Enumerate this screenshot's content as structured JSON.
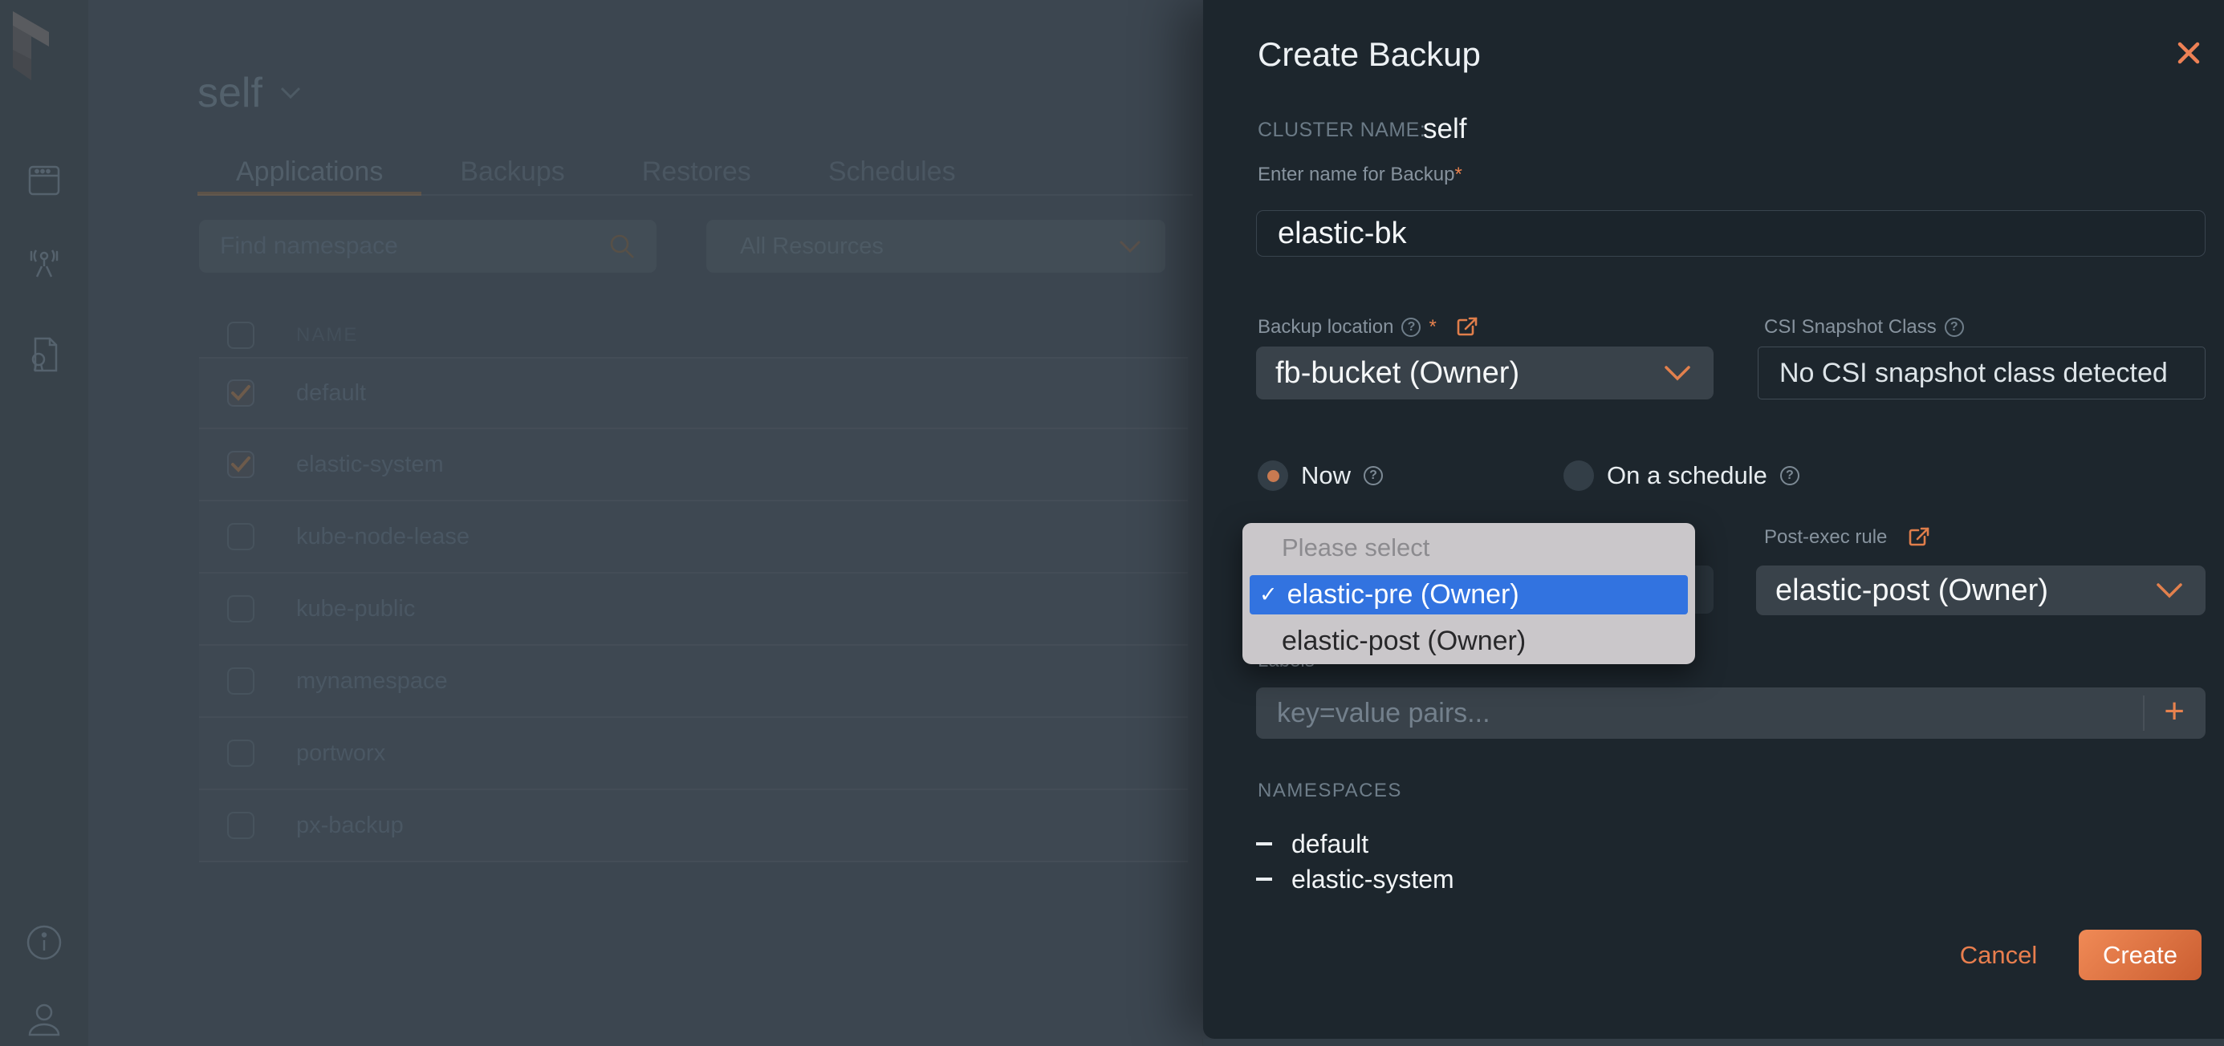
{
  "colors": {
    "accent_orange": "#e8824e",
    "muted_orange_dim": "#6d5b4b",
    "panel_bg": "#1d262d",
    "main_dim_bg": "#3c4650",
    "sidebar_bg": "#38424a",
    "dropdown_bg": "#39424a",
    "popup_bg": "#cac7ca",
    "popup_selected_blue": "#3273e0",
    "radio_dot": "#c87a51",
    "create_gradient": [
      "#f08a56",
      "#cb5e31"
    ]
  },
  "sidebar": {
    "icons": [
      {
        "name": "portworx-logo"
      },
      {
        "name": "app-window-icon"
      },
      {
        "name": "broadcast-tower-icon"
      },
      {
        "name": "document-badge-icon"
      },
      {
        "name": "info-icon"
      },
      {
        "name": "user-icon"
      }
    ]
  },
  "main": {
    "cluster_title": "self",
    "tabs": [
      {
        "label": "Applications",
        "active": true
      },
      {
        "label": "Backups",
        "active": false
      },
      {
        "label": "Restores",
        "active": false
      },
      {
        "label": "Schedules",
        "active": false
      }
    ],
    "search": {
      "placeholder": "Find namespace",
      "icon": "search-icon"
    },
    "resources_filter": {
      "value": "All Resources",
      "icon": "chevron-down-icon"
    },
    "table": {
      "name_header": "NAME",
      "rows": [
        {
          "name": "default",
          "checked": true
        },
        {
          "name": "elastic-system",
          "checked": true
        },
        {
          "name": "kube-node-lease",
          "checked": false
        },
        {
          "name": "kube-public",
          "checked": false
        },
        {
          "name": "mynamespace",
          "checked": false
        },
        {
          "name": "portworx",
          "checked": false
        },
        {
          "name": "px-backup",
          "checked": false
        }
      ]
    }
  },
  "panel": {
    "title": "Create Backup",
    "close_icon": "close-icon",
    "cluster_label": "CLUSTER NAME:",
    "cluster_value": "self",
    "name_label": "Enter name for Backup",
    "required_mark": "*",
    "name_value": "elastic-bk",
    "backup_location": {
      "label": "Backup location",
      "value": "fb-bucket (Owner)"
    },
    "csi": {
      "label": "CSI Snapshot Class",
      "value": "No CSI snapshot class detected"
    },
    "schedule": {
      "now_label": "Now",
      "schedule_label": "On a schedule",
      "selected": "now"
    },
    "rule_popup": {
      "placeholder_option": "Please select",
      "options": [
        {
          "label": "elastic-pre (Owner)",
          "selected": true
        },
        {
          "label": "elastic-post (Owner)",
          "selected": false
        }
      ],
      "check_glyph": "✓"
    },
    "post_exec": {
      "label": "Post-exec rule",
      "value": "elastic-post (Owner)"
    },
    "labels_field": {
      "label": "Labels",
      "placeholder": "key=value pairs...",
      "add_glyph": "+"
    },
    "namespaces": {
      "label": "NAMESPACES",
      "items": [
        "default",
        "elastic-system"
      ]
    },
    "cancel_label": "Cancel",
    "create_label": "Create"
  }
}
